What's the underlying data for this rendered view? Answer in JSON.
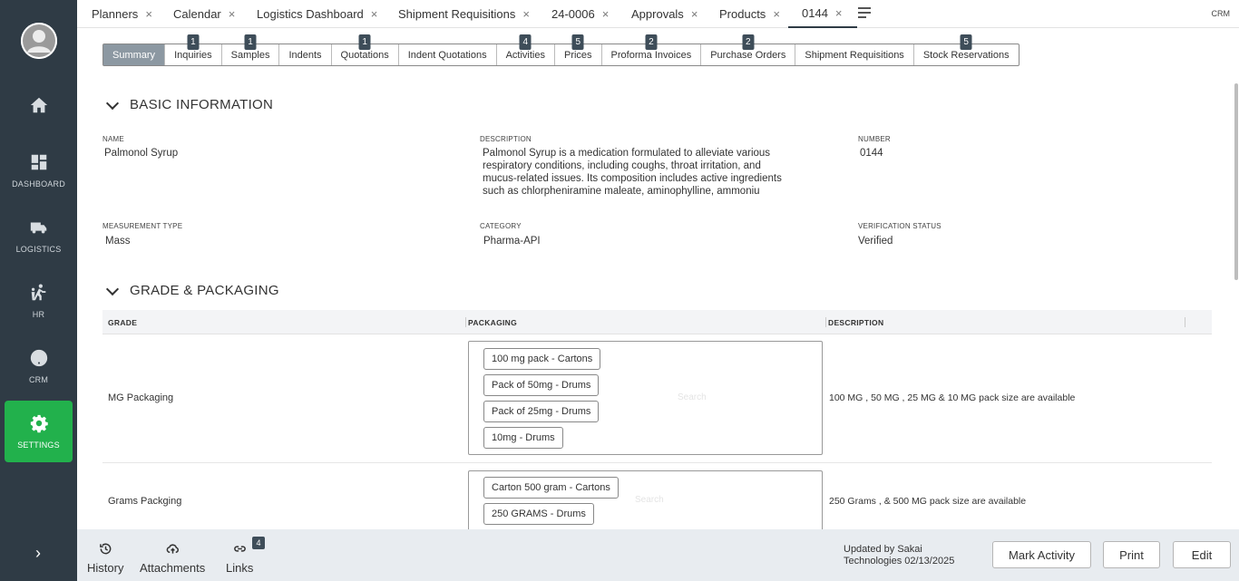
{
  "sidebar": {
    "items": [
      {
        "label": "",
        "icon": "home-icon"
      },
      {
        "label": "DASHBOARD",
        "icon": "dashboard-icon"
      },
      {
        "label": "LOGISTICS",
        "icon": "truck-icon"
      },
      {
        "label": "HR",
        "icon": "people-icon"
      },
      {
        "label": "CRM",
        "icon": "help-icon"
      },
      {
        "label": "SETTINGS",
        "icon": "gear-icon",
        "active": true
      }
    ],
    "expand_glyph": "›",
    "active_color": "#22b14c"
  },
  "top_tabs": [
    {
      "label": "Planners"
    },
    {
      "label": "Calendar"
    },
    {
      "label": "Logistics Dashboard"
    },
    {
      "label": "Shipment Requisitions"
    },
    {
      "label": "24-0006"
    },
    {
      "label": "Approvals"
    },
    {
      "label": "Products"
    },
    {
      "label": "0144",
      "active": true
    }
  ],
  "close_glyph": "×",
  "top_right_label": "CRM",
  "sub_tabs": [
    {
      "label": "Summary",
      "active": true,
      "badge": ""
    },
    {
      "label": "Inquiries",
      "badge": "1"
    },
    {
      "label": "Samples",
      "badge": "1"
    },
    {
      "label": "Indents",
      "badge": ""
    },
    {
      "label": "Quotations",
      "badge": "1"
    },
    {
      "label": "Indent Quotations",
      "badge": ""
    },
    {
      "label": "Activities",
      "badge": "4"
    },
    {
      "label": "Prices",
      "badge": "5"
    },
    {
      "label": "Proforma Invoices",
      "badge": "2"
    },
    {
      "label": "Purchase Orders",
      "badge": "2"
    },
    {
      "label": "Shipment Requisitions",
      "badge": ""
    },
    {
      "label": "Stock Reservations",
      "badge": "5"
    }
  ],
  "basic_info": {
    "title": "BASIC INFORMATION",
    "name_label": "NAME",
    "name_value": "Palmonol Syrup",
    "description_label": "DESCRIPTION",
    "description_lines": [
      "Palmonol Syrup is a medication formulated to alleviate various",
      "respiratory conditions, including coughs, throat irritation, and",
      "mucus-related issues. Its composition includes active ingredients",
      "such as chlorpheniramine maleate, aminophylline, ammoniu"
    ],
    "number_label": "NUMBER",
    "number_value": "0144",
    "measurement_label": "MEASUREMENT TYPE",
    "measurement_value": "Mass",
    "category_label": "CATEGORY",
    "category_value": "Pharma-API",
    "verification_label": "VERIFICATION STATUS",
    "verification_value": "Verified"
  },
  "grade_packaging": {
    "title": "GRADE & PACKAGING",
    "columns": [
      "GRADE",
      "PACKAGING",
      "DESCRIPTION"
    ],
    "rows": [
      {
        "grade": "MG Packaging",
        "packaging": [
          "100 mg pack - Cartons",
          "Pack of 50mg - Drums",
          "Pack of 25mg - Drums",
          "10mg - Drums"
        ],
        "search_placeholder": "Search",
        "description": "100 MG , 50 MG , 25 MG & 10 MG pack size are available"
      },
      {
        "grade": "Grams Packging",
        "packaging": [
          "Carton 500 gram - Cartons",
          "250 GRAMS - Drums"
        ],
        "search_placeholder": "Search",
        "description": "250 Grams , & 500 MG pack size are available"
      }
    ]
  },
  "footer": {
    "history_label": "History",
    "attachments_label": "Attachments",
    "links_label": "Links",
    "links_count": "4",
    "updated_line1": "Updated by Sakai",
    "updated_line2": "Technologies 02/13/2025",
    "mark_activity_label": "Mark Activity",
    "print_label": "Print",
    "edit_label": "Edit"
  }
}
